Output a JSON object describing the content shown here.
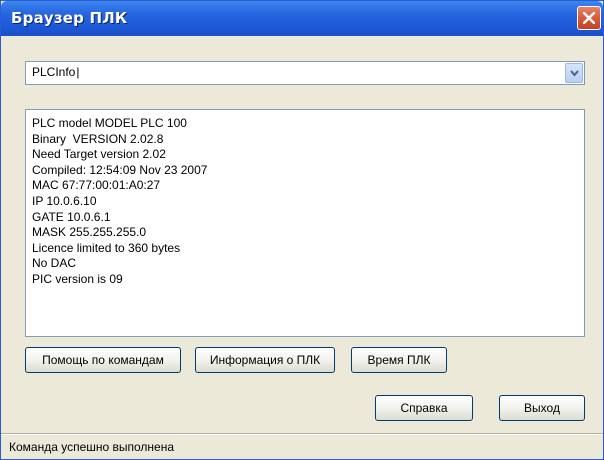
{
  "window": {
    "title": "Браузер ПЛК"
  },
  "command_combo": {
    "value": "PLCInfo"
  },
  "output": {
    "lines": [
      "PLC model MODEL PLC 100",
      "Binary  VERSION 2.02.8",
      "Need Target version 2.02",
      "Compiled: 12:54:09 Nov 23 2007",
      "MAC 67:77:00:01:A0:27",
      "IP 10.0.6.10",
      "GATE 10.0.6.1",
      "MASK 255.255.255.0",
      "Licence limited to 360 bytes",
      "No DAC",
      "PIC version is 09"
    ]
  },
  "buttons": {
    "help_commands": "Помощь по командам",
    "plc_info": "Информация о ПЛК",
    "plc_time": "Время ПЛК",
    "help": "Справка",
    "exit": "Выход"
  },
  "status": {
    "text": "Команда успешно выполнена"
  },
  "colors": {
    "titlebar": "#2766e0",
    "window_bg": "#ece9d8",
    "close_button": "#d85a3c"
  },
  "icons": {
    "close": "close-icon",
    "dropdown": "chevron-down-icon"
  }
}
